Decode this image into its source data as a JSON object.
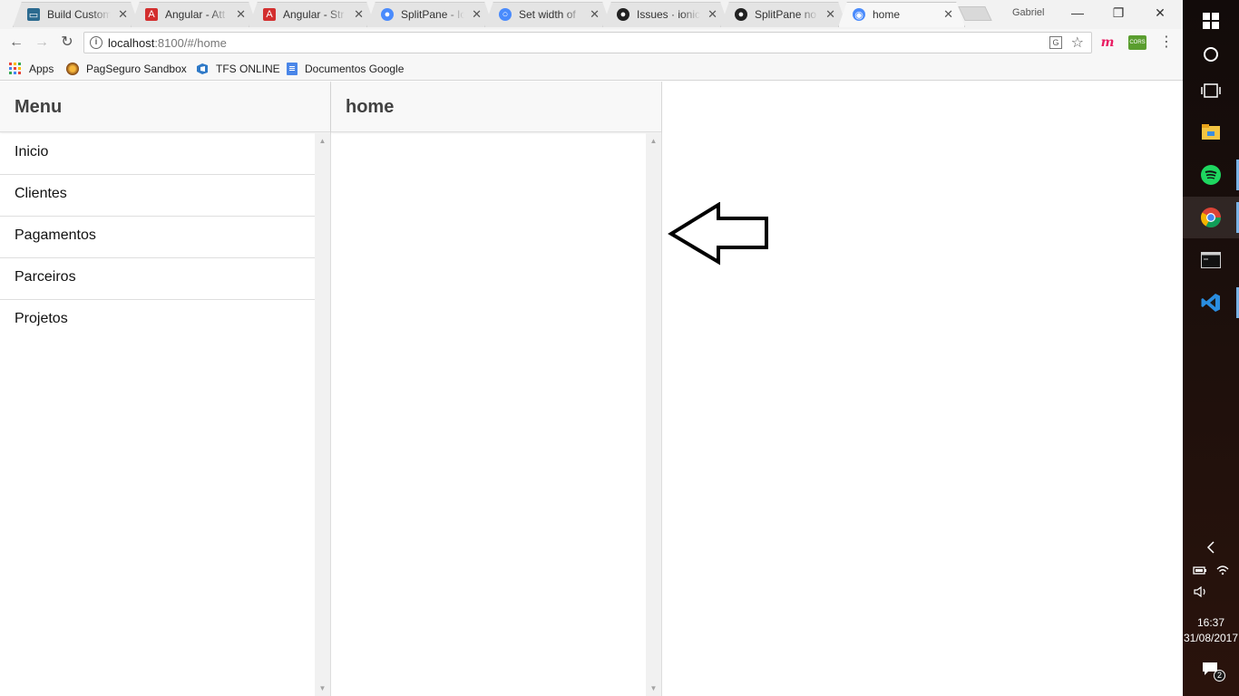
{
  "browser": {
    "tabs": [
      {
        "title": "Build Custom",
        "favicon": "monitor-icon",
        "color": "#2b6a8f"
      },
      {
        "title": "Angular - Att",
        "favicon": "angular-icon",
        "color": "#d32f2f"
      },
      {
        "title": "Angular - Str",
        "favicon": "angular-icon",
        "color": "#d32f2f"
      },
      {
        "title": "SplitPane - Io",
        "favicon": "ionic-icon",
        "color": "#4a8bfc"
      },
      {
        "title": "Set width of",
        "favicon": "search-icon",
        "color": "#4a8bfc"
      },
      {
        "title": "Issues · ionic",
        "favicon": "github-icon",
        "color": "#222222"
      },
      {
        "title": "SplitPane no",
        "favicon": "github-icon",
        "color": "#222222"
      },
      {
        "title": "home",
        "favicon": "ionic-icon",
        "color": "#4a8bfc"
      }
    ],
    "tab_close": "✕",
    "profile": "Gabriel",
    "url_host": "localhost",
    "url_rest": ":8100/#/home",
    "bookmarks": [
      {
        "label": "Apps",
        "icon": "apps-grid-icon"
      },
      {
        "label": "PagSeguro Sandbox",
        "icon": "pagseguro-icon"
      },
      {
        "label": "TFS ONLINE",
        "icon": "tfs-icon"
      },
      {
        "label": "Documentos Google",
        "icon": "docs-icon"
      }
    ],
    "extensions": {
      "m": "m",
      "cors": "CORS"
    }
  },
  "app": {
    "menu_title": "Menu",
    "menu_items": [
      "Inicio",
      "Clientes",
      "Pagamentos",
      "Parceiros",
      "Projetos"
    ],
    "content_title": "home"
  },
  "taskbar": {
    "time": "16:37",
    "date": "31/08/2017",
    "notifications": "2"
  }
}
